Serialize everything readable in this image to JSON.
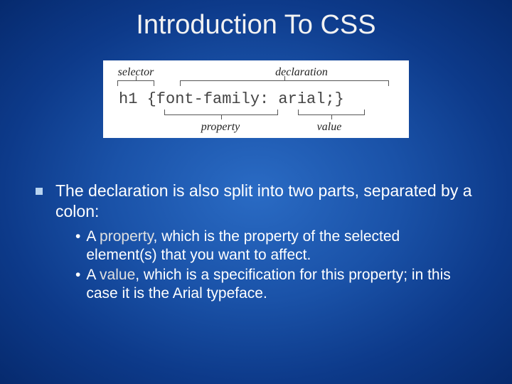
{
  "title": "Introduction To CSS",
  "diagram": {
    "top_left": "selector",
    "top_right": "declaration",
    "code": "h1 {font-family: arial;}",
    "bottom_left": "property",
    "bottom_right": "value"
  },
  "main_point": "The declaration is also split into two parts, separated by a colon:",
  "sub1_lead": "A ",
  "sub1_em": "property",
  "sub1_rest": ", which is the property of the selected element(s) that you want to affect.",
  "sub2_lead": "A ",
  "sub2_em": "value",
  "sub2_rest": ", which is a specification for this property; in this case it is the Arial typeface."
}
